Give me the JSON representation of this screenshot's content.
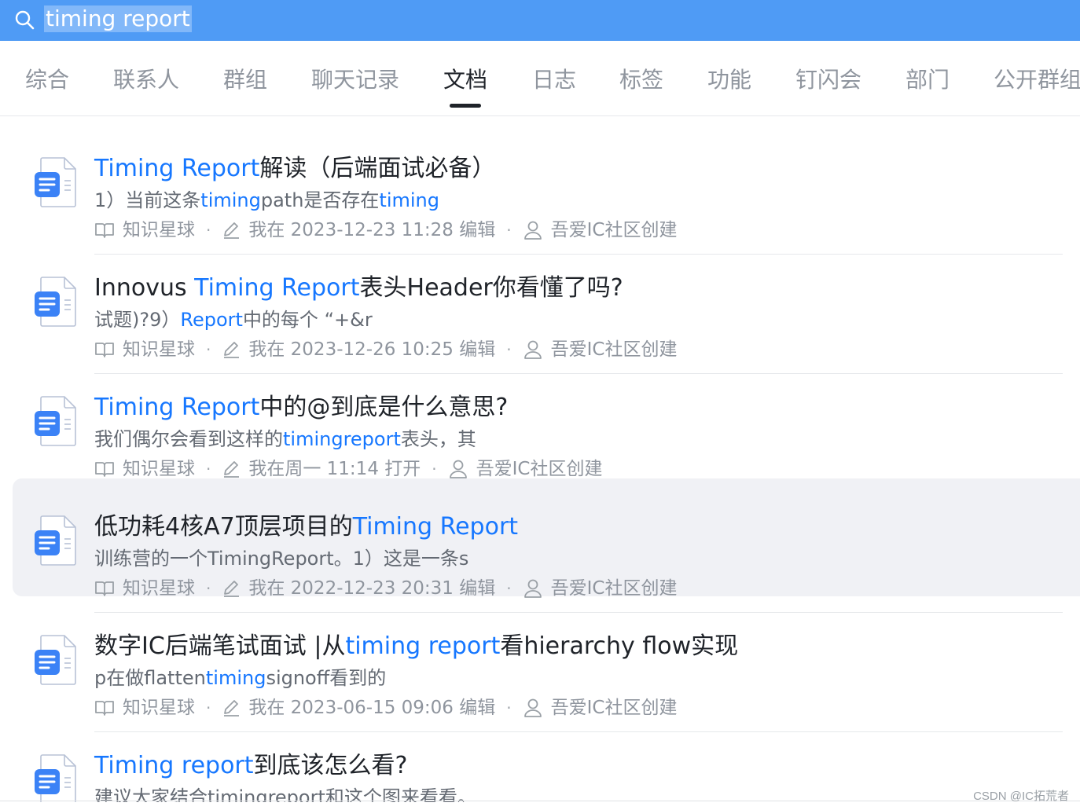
{
  "search": {
    "query": "timing report"
  },
  "tabs": [
    {
      "label": "综合",
      "active": false
    },
    {
      "label": "联系人",
      "active": false
    },
    {
      "label": "群组",
      "active": false
    },
    {
      "label": "聊天记录",
      "active": false
    },
    {
      "label": "文档",
      "active": true
    },
    {
      "label": "日志",
      "active": false
    },
    {
      "label": "标签",
      "active": false
    },
    {
      "label": "功能",
      "active": false
    },
    {
      "label": "钉闪会",
      "active": false
    },
    {
      "label": "部门",
      "active": false
    },
    {
      "label": "公开群组",
      "active": false
    }
  ],
  "results": [
    {
      "icon": "doc-icon",
      "title": [
        {
          "text": "Timing Report",
          "hl": true
        },
        {
          "text": "解读（后端面试必备）",
          "hl": false
        }
      ],
      "snippet": [
        {
          "text": "1）当前这条",
          "hl": false
        },
        {
          "text": "timing",
          "hl": true
        },
        {
          "text": "path是否存在",
          "hl": false
        },
        {
          "text": "timing",
          "hl": true
        }
      ],
      "source": "知识星球",
      "action": "我在 2023-12-23 11:28 编辑",
      "creator": "吾爱IC社区创建"
    },
    {
      "icon": "doc-icon",
      "title": [
        {
          "text": "Innovus ",
          "hl": false
        },
        {
          "text": "Timing Report",
          "hl": true
        },
        {
          "text": "表头Header你看懂了吗?",
          "hl": false
        }
      ],
      "snippet": [
        {
          "text": "试题)?9）",
          "hl": false
        },
        {
          "text": "Report",
          "hl": true
        },
        {
          "text": "中的每个 “+&r",
          "hl": false
        }
      ],
      "source": "知识星球",
      "action": "我在 2023-12-26 10:25 编辑",
      "creator": "吾爱IC社区创建"
    },
    {
      "icon": "doc-icon",
      "title": [
        {
          "text": "Timing Report",
          "hl": true
        },
        {
          "text": "中的@到底是什么意思?",
          "hl": false
        }
      ],
      "snippet": [
        {
          "text": "我们偶尔会看到这样的",
          "hl": false
        },
        {
          "text": "timingreport",
          "hl": true
        },
        {
          "text": "表头，其",
          "hl": false
        }
      ],
      "source": "知识星球",
      "action": "我在周一 11:14 打开",
      "creator": "吾爱IC社区创建"
    },
    {
      "icon": "doc-icon",
      "title": [
        {
          "text": "低功耗4核A7顶层项目的",
          "hl": false
        },
        {
          "text": "Timing Report",
          "hl": true
        }
      ],
      "snippet": [
        {
          "text": "训练营的一个TimingReport。1）这是一条s",
          "hl": false
        }
      ],
      "source": "知识星球",
      "action": "我在 2022-12-23 20:31 编辑",
      "creator": "吾爱IC社区创建"
    },
    {
      "icon": "doc-icon",
      "title": [
        {
          "text": "数字IC后端笔试面试 |从",
          "hl": false
        },
        {
          "text": "timing report",
          "hl": true
        },
        {
          "text": "看hierarchy flow实现",
          "hl": false
        }
      ],
      "snippet": [
        {
          "text": "p在做flatten",
          "hl": false
        },
        {
          "text": "timing",
          "hl": true
        },
        {
          "text": "signoff看到的",
          "hl": false
        }
      ],
      "source": "知识星球",
      "action": "我在 2023-06-15 09:06 编辑",
      "creator": "吾爱IC社区创建"
    },
    {
      "icon": "doc-icon",
      "title": [
        {
          "text": "Timing report",
          "hl": true
        },
        {
          "text": "到底该怎么看?",
          "hl": false
        }
      ],
      "snippet": [
        {
          "text": "建议大家结合timingreport和这个图来看看。",
          "hl": false
        }
      ],
      "source": "",
      "action": "",
      "creator": ""
    }
  ],
  "hovered_result": 3,
  "watermark": "CSDN @IC拓荒者",
  "colors": {
    "search_bar": "#4f9bf5",
    "highlight": "#1677ff",
    "hover_row": "#f0f1f5",
    "doc_icon_blue": "#3b82f6"
  }
}
